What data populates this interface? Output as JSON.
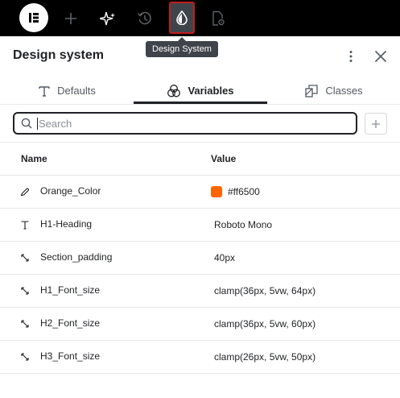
{
  "topbar": {
    "logo_icon": "elementor-logo-icon",
    "buttons": [
      {
        "name": "add-element-button",
        "icon": "plus-icon"
      },
      {
        "name": "ai-sparkle-button",
        "icon": "sparkle-icon"
      },
      {
        "name": "history-button",
        "icon": "history-icon"
      },
      {
        "name": "design-system-button",
        "icon": "droplet-icon",
        "active": true
      },
      {
        "name": "page-settings-button",
        "icon": "page-settings-icon"
      }
    ],
    "tooltip": "Design System"
  },
  "panel": {
    "title": "Design system",
    "tabs": [
      {
        "label": "Defaults",
        "icon": "text-t-icon"
      },
      {
        "label": "Variables",
        "icon": "circles-icon",
        "active": true
      },
      {
        "label": "Classes",
        "icon": "shapes-icon"
      }
    ],
    "search": {
      "placeholder": "Search",
      "value": ""
    },
    "table": {
      "headers": {
        "name": "Name",
        "value": "Value"
      },
      "rows": [
        {
          "type": "color",
          "name": "Orange_Color",
          "value": "#ff6500",
          "swatch": "#ff6500"
        },
        {
          "type": "font",
          "name": "H1-Heading",
          "value": "Roboto Mono"
        },
        {
          "type": "size",
          "name": "Section_padding",
          "value": "40px"
        },
        {
          "type": "size",
          "name": "H1_Font_size",
          "value": "clamp(36px, 5vw, 64px)"
        },
        {
          "type": "size",
          "name": "H2_Font_size",
          "value": "clamp(36px, 5vw, 60px)"
        },
        {
          "type": "size",
          "name": "H3_Font_size",
          "value": "clamp(26px, 5vw, 50px)"
        }
      ]
    }
  },
  "colors": {
    "accent_swatch": "#ff6500",
    "active_outline": "#c21d1d",
    "topbar_bg": "#000000"
  }
}
